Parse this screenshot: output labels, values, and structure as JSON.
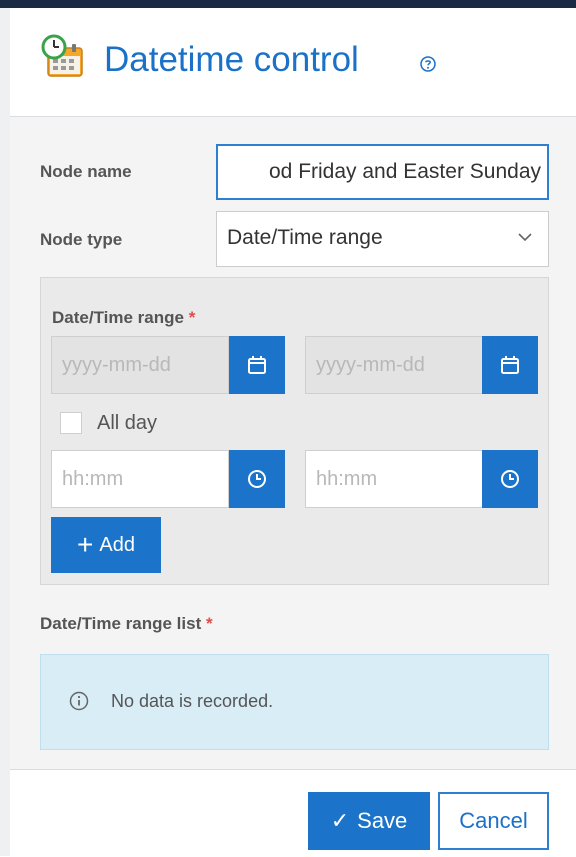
{
  "header": {
    "title": "Datetime control",
    "icon": "calendar-clock-icon",
    "help_icon": "help-circle-icon"
  },
  "form": {
    "node_name": {
      "label": "Node name",
      "value": "od Friday and Easter Sunday"
    },
    "node_type": {
      "label": "Node type",
      "selected": "Date/Time range"
    }
  },
  "range_panel": {
    "label": "Date/Time range",
    "required_mark": "*",
    "start_date_placeholder": "yyyy-mm-dd",
    "end_date_placeholder": "yyyy-mm-dd",
    "all_day_label": "All day",
    "start_time_placeholder": "hh:mm",
    "end_time_placeholder": "hh:mm",
    "add_label": "Add"
  },
  "range_list": {
    "label": "Date/Time range list",
    "required_mark": "*",
    "empty_message": "No data is recorded."
  },
  "footer": {
    "save_label": "Save",
    "cancel_label": "Cancel"
  },
  "colors": {
    "accent": "#1b74c9",
    "title": "#1b71c8",
    "info_bg": "#d9edf7",
    "required": "#e04b4b"
  }
}
